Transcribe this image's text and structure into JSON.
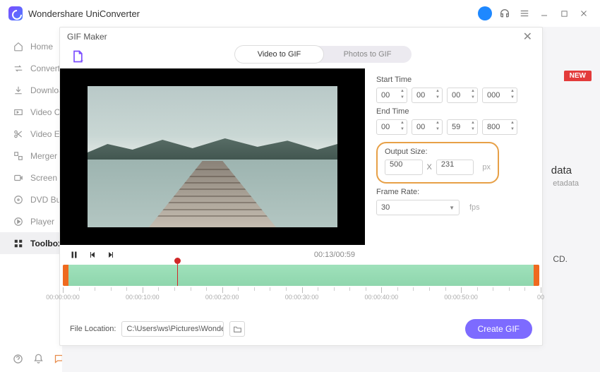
{
  "app": {
    "title": "Wondershare UniConverter"
  },
  "sidebar": {
    "items": [
      {
        "label": "Home"
      },
      {
        "label": "Converter"
      },
      {
        "label": "Downloader"
      },
      {
        "label": "Video Compressor"
      },
      {
        "label": "Video Editor"
      },
      {
        "label": "Merger"
      },
      {
        "label": "Screen Recorder"
      },
      {
        "label": "DVD Burner"
      },
      {
        "label": "Player"
      },
      {
        "label": "Toolbox"
      }
    ]
  },
  "bg": {
    "new_badge": "NEW",
    "meta1": "data",
    "meta2": "etadata",
    "meta3": "CD."
  },
  "modal": {
    "title": "GIF Maker",
    "tabs": {
      "video": "Video to GIF",
      "photos": "Photos to GIF"
    },
    "start_label": "Start Time",
    "end_label": "End Time",
    "start": {
      "h": "00",
      "m": "00",
      "s": "00",
      "ms": "000"
    },
    "end": {
      "h": "00",
      "m": "00",
      "s": "59",
      "ms": "800"
    },
    "output_label": "Output Size:",
    "output": {
      "w": "500",
      "sep": "X",
      "h": "231",
      "unit": "px"
    },
    "framerate_label": "Frame Rate:",
    "framerate": {
      "value": "30",
      "unit": "fps"
    },
    "time_display": "00:13/00:59",
    "timeline_ticks": [
      "00:00:00:00",
      "00:00:10:00",
      "00:00:20:00",
      "00:00:30:00",
      "00:00:40:00",
      "00:00:50:00",
      "00"
    ],
    "file_label": "File Location:",
    "file_path": "C:\\Users\\ws\\Pictures\\Wonders",
    "create_label": "Create GIF"
  }
}
